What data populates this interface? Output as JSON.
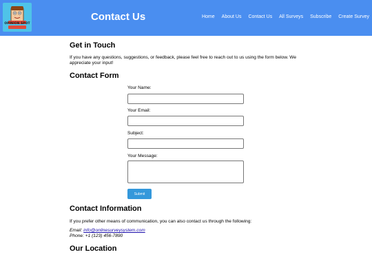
{
  "header": {
    "logo_text": "OPINION SPOT",
    "title": "Contact Us",
    "nav": [
      "Home",
      "About Us",
      "Contact Us",
      "All Surveys",
      "Subscribe",
      "Create Survey"
    ]
  },
  "get_in_touch": {
    "heading": "Get in Touch",
    "text": "If you have any questions, suggestions, or feedback, please feel free to reach out to us using the form below. We appreciate your input!"
  },
  "contact_form": {
    "heading": "Contact Form",
    "name_label": "Your Name:",
    "email_label": "Your Email:",
    "subject_label": "Subject:",
    "message_label": "Your Message:",
    "name_value": "",
    "email_value": "",
    "subject_value": "",
    "message_value": "",
    "submit_label": "Submit"
  },
  "contact_info": {
    "heading": "Contact Information",
    "text": "If you prefer other means of communication, you can also contact us through the following:",
    "email_label": "Email:",
    "email": "info@onlinesurveysystem.com",
    "phone_label": "Phone:",
    "phone": "+1 (123) 456-7890"
  },
  "location": {
    "heading": "Our Location"
  },
  "colors": {
    "header_bg": "#4a8ef0",
    "submit_bg": "#3498db",
    "logo_bg": "#4fc3e8"
  }
}
